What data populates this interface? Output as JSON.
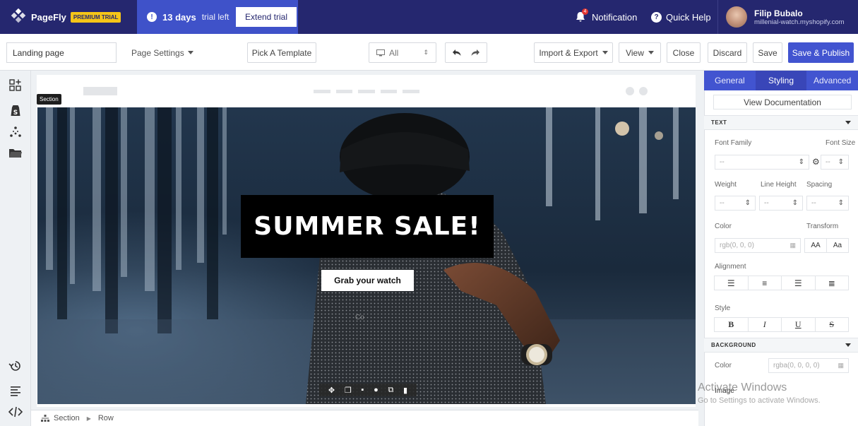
{
  "topbar": {
    "brand": "PageFly",
    "badge": "PREMIUM TRIAL",
    "trial_days": "13 days",
    "trial_suffix": "trial left",
    "extend_label": "Extend trial",
    "notification_label": "Notification",
    "notification_count": "4",
    "help_label": "Quick Help",
    "user_name": "Filip Bubalo",
    "user_shop": "millenial-watch.myshopify.com"
  },
  "toolbar": {
    "page_name": "Landing page",
    "page_settings": "Page Settings",
    "pick_template": "Pick A Template",
    "device": "All",
    "import_export": "Import & Export",
    "view": "View",
    "close": "Close",
    "discard": "Discard",
    "save": "Save",
    "save_publish": "Save & Publish"
  },
  "canvas": {
    "section_tag": "Section",
    "headline": "SUMMER SALE!",
    "cta": "Grab your watch",
    "column_hint": "Co"
  },
  "breadcrumb": {
    "items": [
      "Section",
      "Row"
    ]
  },
  "panel": {
    "tabs": [
      "General",
      "Styling",
      "Advanced"
    ],
    "active_tab": "Styling",
    "doc_label": "View Documentation",
    "text_section": "TEXT",
    "font_family_label": "Font Family",
    "font_size_label": "Font Size",
    "weight_label": "Weight",
    "line_height_label": "Line Height",
    "spacing_label": "Spacing",
    "empty_value": "--",
    "color_label": "Color",
    "color_value": "rgb(0, 0, 0)",
    "transform_label": "Transform",
    "transform_upper": "AA",
    "transform_cap": "Aa",
    "alignment_label": "Alignment",
    "style_label": "Style",
    "style_bold": "B",
    "style_italic": "I",
    "style_underline": "U",
    "style_strike": "S",
    "background_section": "BACKGROUND",
    "bg_color_label": "Color",
    "bg_color_value": "rgba(0, 0, 0, 0)",
    "image_label": "Image"
  },
  "watermark": {
    "line1": "Activate Windows",
    "line2": "Go to Settings to activate Windows."
  },
  "colors": {
    "topbar": "#25276f",
    "accent": "#4254d0",
    "trial_bg": "#3f52c9"
  }
}
